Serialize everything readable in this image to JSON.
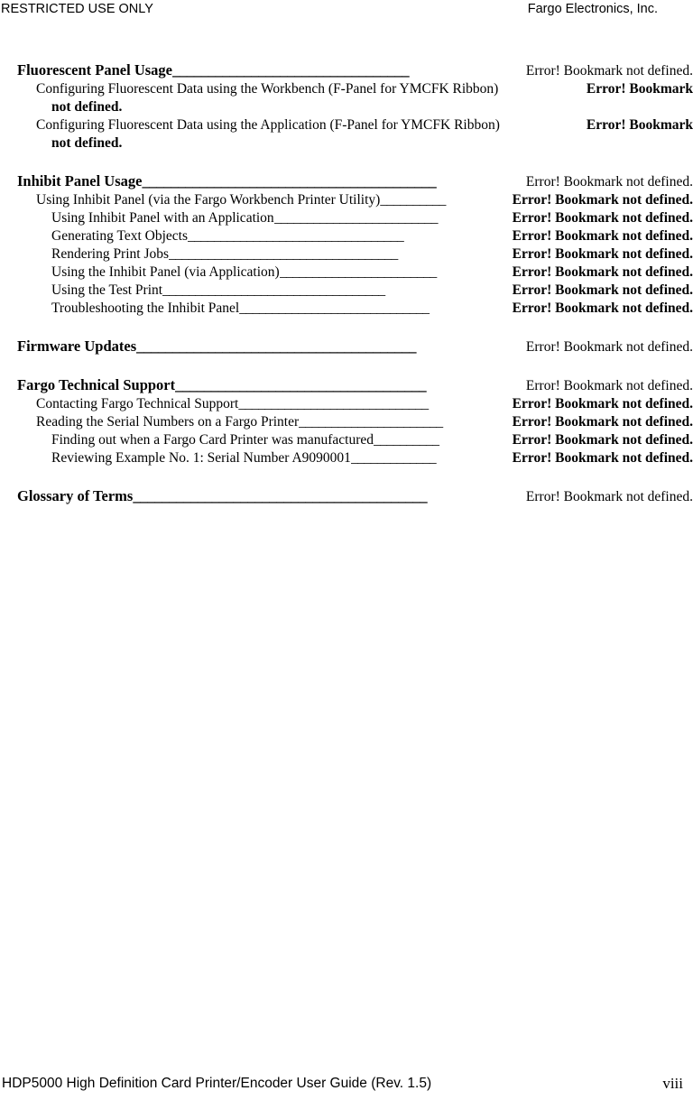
{
  "header": {
    "left": "RESTRICTED USE ONLY",
    "right": "Fargo Electronics, Inc."
  },
  "footer": {
    "left": "HDP5000 High Definition Card Printer/Encoder User Guide (Rev. 1.5)",
    "page_number": "viii"
  },
  "page_ref_normal": "Error! Bookmark not defined.",
  "page_ref_bold": "Error! Bookmark not defined.",
  "leader_char": "_",
  "toc": {
    "entries": [
      {
        "level": 1,
        "title": "Fluorescent Panel Usage ",
        "page_ref": "Error! Bookmark not defined.",
        "leader": "_________________________________",
        "gap_before": true
      },
      {
        "level": 2,
        "title": "Configuring Fluorescent Data using the Workbench (F-Panel for YMCFK Ribbon)",
        "page_ref": "Error! Bookmark",
        "leader": "  ",
        "wrap": "not defined.",
        "no_leader": true
      },
      {
        "level": 2,
        "title": "Configuring Fluorescent Data using the Application (F-Panel for YMCFK Ribbon)",
        "page_ref": "Error! Bookmark",
        "leader": "  ",
        "wrap": "not defined.",
        "no_leader": true
      },
      {
        "level": 1,
        "title": "Inhibit Panel Usage ",
        "page_ref": "Error! Bookmark not defined.",
        "leader": "_________________________________________",
        "gap_before": true
      },
      {
        "level": 2,
        "title": "Using Inhibit Panel (via the Fargo Workbench Printer Utility)",
        "page_ref": "Error! Bookmark not defined.",
        "leader": "__________"
      },
      {
        "level": 3,
        "title": "Using Inhibit Panel with an Application",
        "page_ref": "Error! Bookmark not defined.",
        "leader": "_________________________"
      },
      {
        "level": 3,
        "title": "Generating Text Objects ",
        "page_ref": "Error! Bookmark not defined.",
        "leader": "_________________________________"
      },
      {
        "level": 3,
        "title": "Rendering Print Jobs",
        "page_ref": "Error! Bookmark not defined.",
        "leader": "___________________________________"
      },
      {
        "level": 3,
        "title": "Using the Inhibit Panel (via Application)",
        "page_ref": "Error! Bookmark not defined.",
        "leader": "________________________"
      },
      {
        "level": 3,
        "title": "Using the Test Print ",
        "page_ref": "Error! Bookmark not defined.",
        "leader": "__________________________________"
      },
      {
        "level": 3,
        "title": "Troubleshooting the Inhibit Panel  ",
        "page_ref": "Error! Bookmark not defined.",
        "leader": "_____________________________"
      },
      {
        "level": 1,
        "title": "Firmware Updates  ",
        "page_ref": "Error! Bookmark not defined.",
        "leader": "_______________________________________",
        "gap_before": true
      },
      {
        "level": 1,
        "title": "Fargo Technical Support  ",
        "page_ref": "Error! Bookmark not defined.",
        "leader": "___________________________________",
        "gap_before": true
      },
      {
        "level": 2,
        "title": "Contacting Fargo Technical Support",
        "page_ref": "Error! Bookmark not defined.",
        "leader": "_____________________________"
      },
      {
        "level": 2,
        "title": "Reading the Serial Numbers on a Fargo Printer ",
        "page_ref": "Error! Bookmark not defined.",
        "leader": "______________________"
      },
      {
        "level": 3,
        "title": "Finding out when a Fargo Card Printer was manufactured ",
        "page_ref": "Error! Bookmark not defined.",
        "leader": "__________"
      },
      {
        "level": 3,
        "title": "Reviewing Example No. 1:  Serial Number A9090001 ",
        "page_ref": "Error! Bookmark not defined.",
        "leader": "_____________"
      },
      {
        "level": 1,
        "title": "Glossary of Terms",
        "page_ref": "Error! Bookmark not defined.",
        "leader": "_________________________________________",
        "gap_before": true
      }
    ]
  }
}
